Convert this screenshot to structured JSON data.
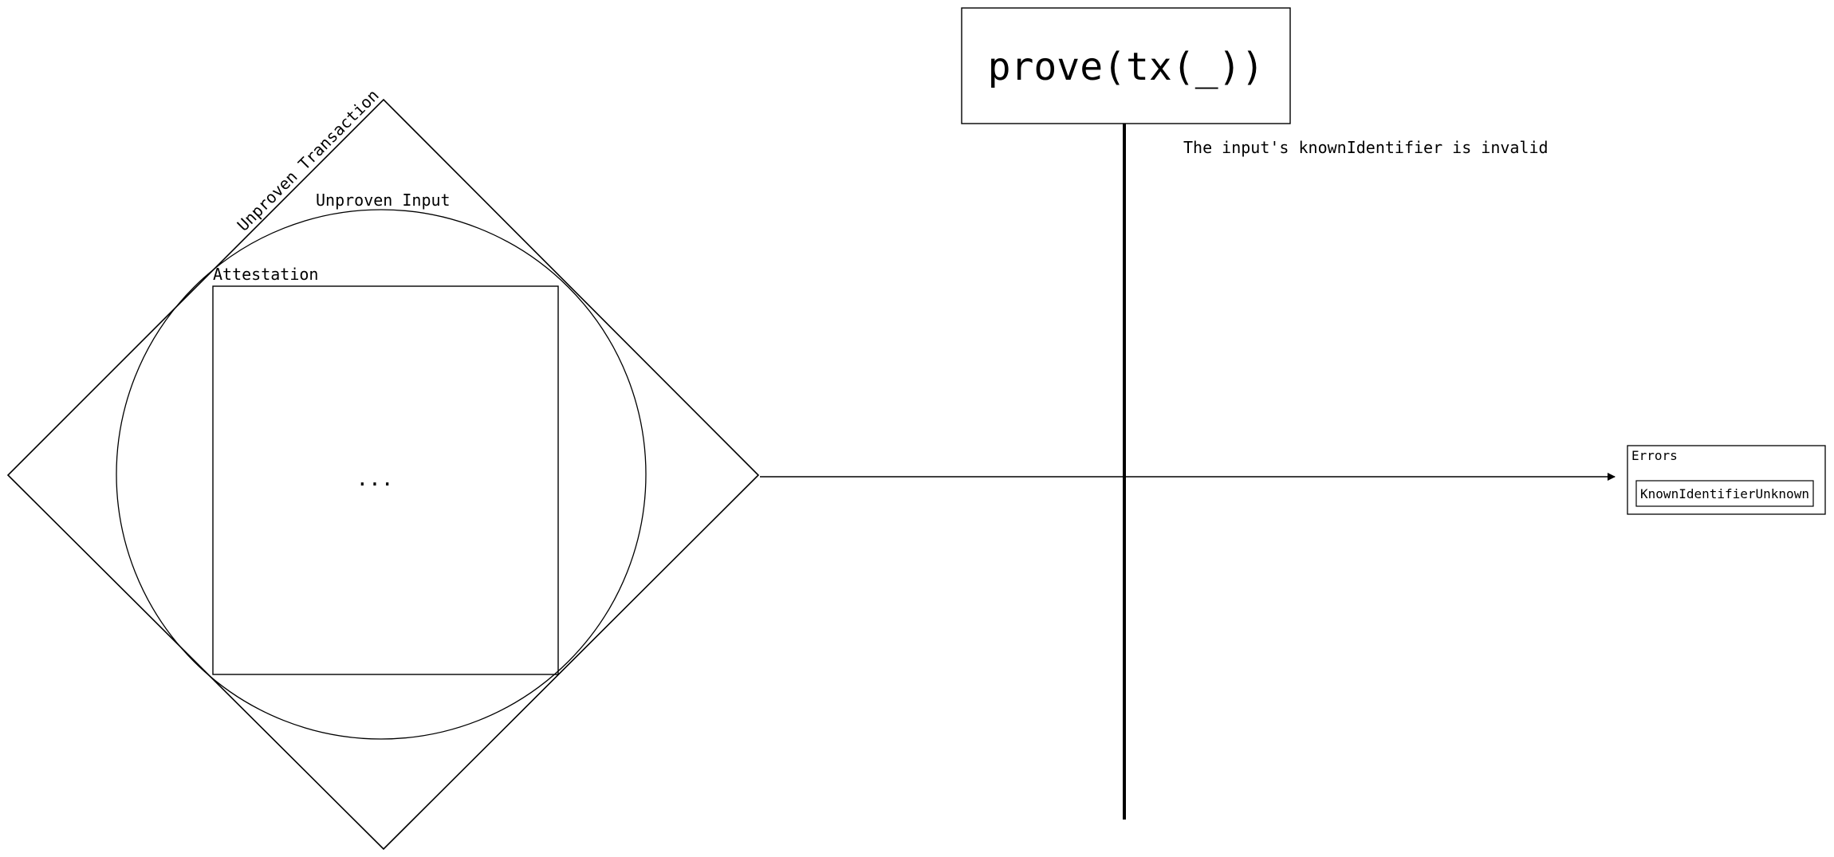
{
  "transaction": {
    "label": "Unproven Transaction",
    "input": {
      "label": "Unproven Input",
      "attestation": {
        "label": "Attestation",
        "content": "..."
      }
    }
  },
  "function_box": {
    "label": "prove(tx(_))"
  },
  "barrier": {
    "reason": "The input's knownIdentifier is invalid"
  },
  "errors": {
    "title": "Errors",
    "items": [
      "KnownIdentifierUnknown"
    ]
  }
}
